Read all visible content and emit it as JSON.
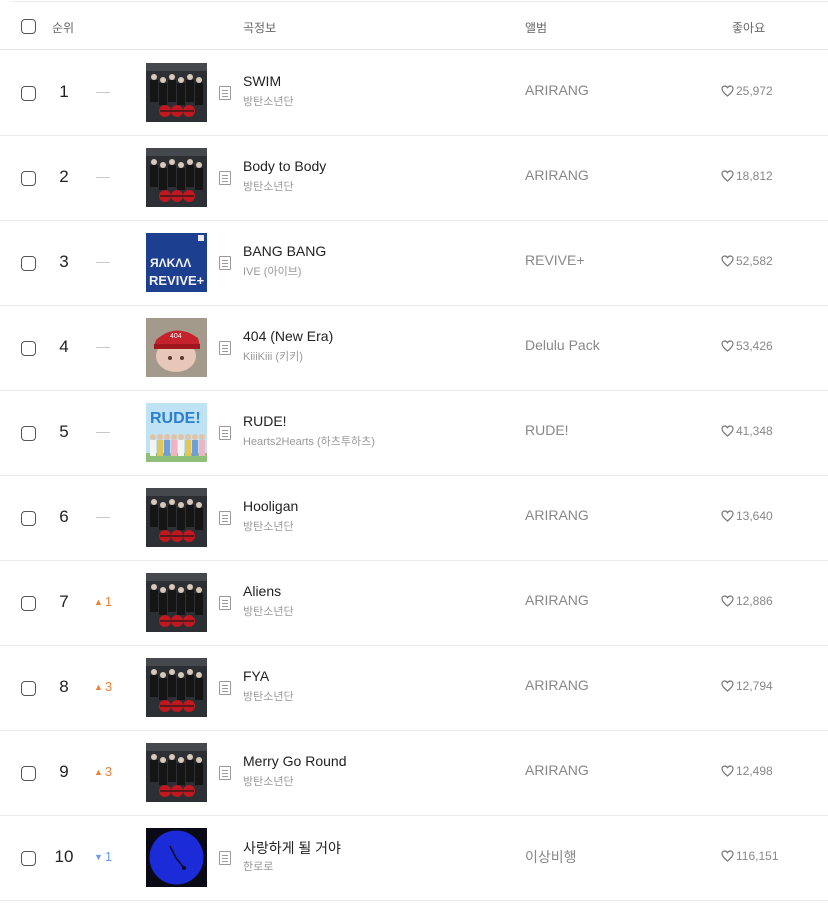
{
  "header": {
    "rank": "순위",
    "song_info": "곡정보",
    "album": "앨범",
    "likes": "좋아요"
  },
  "rows": [
    {
      "rank": "1",
      "change_type": "same",
      "change": "",
      "cover": "group-dark-cover",
      "title": "SWIM",
      "artist": "방탄소년단",
      "album": "ARIRANG",
      "likes": "25,972"
    },
    {
      "rank": "2",
      "change_type": "same",
      "change": "",
      "cover": "group-dark-cover",
      "title": "Body to Body",
      "artist": "방탄소년단",
      "album": "ARIRANG",
      "likes": "18,812"
    },
    {
      "rank": "3",
      "change_type": "same",
      "change": "",
      "cover": "blue-revive-cover",
      "title": "BANG BANG",
      "artist": "IVE (아이브)",
      "album": "REVIVE+",
      "likes": "52,582"
    },
    {
      "rank": "4",
      "change_type": "same",
      "change": "",
      "cover": "red-cap-cover",
      "title": "404 (New Era)",
      "artist": "KiiiKiii (키키)",
      "album": "Delulu Pack",
      "likes": "53,426"
    },
    {
      "rank": "5",
      "change_type": "same",
      "change": "",
      "cover": "sky-group-cover",
      "title": "RUDE!",
      "artist": "Hearts2Hearts (하츠투하츠)",
      "album": "RUDE!",
      "likes": "41,348"
    },
    {
      "rank": "6",
      "change_type": "same",
      "change": "",
      "cover": "group-dark-cover",
      "title": "Hooligan",
      "artist": "방탄소년단",
      "album": "ARIRANG",
      "likes": "13,640"
    },
    {
      "rank": "7",
      "change_type": "up",
      "change": "1",
      "cover": "group-dark-cover",
      "title": "Aliens",
      "artist": "방탄소년단",
      "album": "ARIRANG",
      "likes": "12,886"
    },
    {
      "rank": "8",
      "change_type": "up",
      "change": "3",
      "cover": "group-dark-cover",
      "title": "FYA",
      "artist": "방탄소년단",
      "album": "ARIRANG",
      "likes": "12,794"
    },
    {
      "rank": "9",
      "change_type": "up",
      "change": "3",
      "cover": "group-dark-cover",
      "title": "Merry Go Round",
      "artist": "방탄소년단",
      "album": "ARIRANG",
      "likes": "12,498"
    },
    {
      "rank": "10",
      "change_type": "down",
      "change": "1",
      "cover": "blue-circle-cover",
      "title": "사랑하게 될 거야",
      "artist": "한로로",
      "album": "이상비행",
      "likes": "116,151"
    }
  ],
  "colors": {
    "up": "#e8813a",
    "down": "#6b9be8",
    "same": "#c9c9c9"
  }
}
